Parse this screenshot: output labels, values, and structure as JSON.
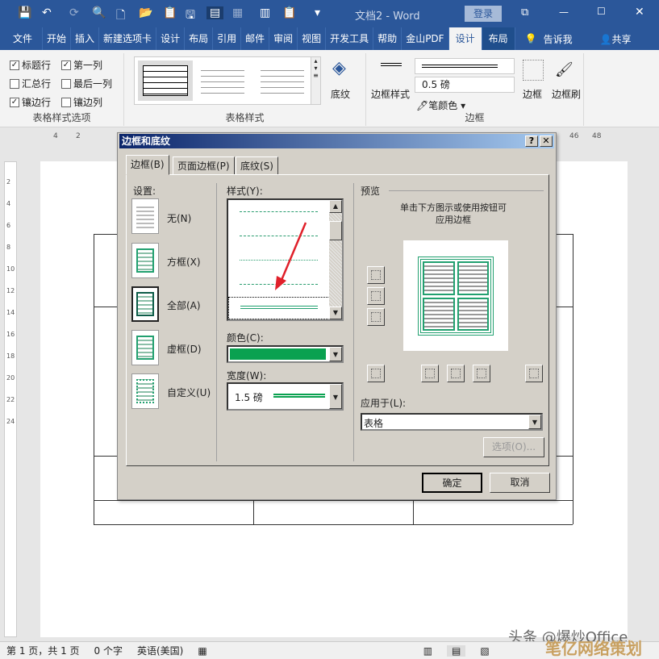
{
  "window": {
    "title": "文档2 - Word",
    "login": "登录",
    "min": "—",
    "max": "☐",
    "close": "✕",
    "restore": "⧉"
  },
  "quick_access": [
    "💾",
    "↶",
    "⟳",
    "🔍",
    "🗋",
    "📂",
    "📋",
    "🖫",
    "▤",
    "▦",
    "▥",
    "📋",
    "▾"
  ],
  "tabs": [
    {
      "label": "文件"
    },
    {
      "label": "开始"
    },
    {
      "label": "插入"
    },
    {
      "label": "新建选项卡"
    },
    {
      "label": "设计"
    },
    {
      "label": "布局"
    },
    {
      "label": "引用"
    },
    {
      "label": "邮件"
    },
    {
      "label": "审阅"
    },
    {
      "label": "视图"
    },
    {
      "label": "开发工具"
    },
    {
      "label": "帮助"
    },
    {
      "label": "金山PDF"
    },
    {
      "label": "设计"
    },
    {
      "label": "布局"
    }
  ],
  "tell_me": "告诉我",
  "share": "共享",
  "ribbon": {
    "style_options": {
      "label": "表格样式选项",
      "items": [
        {
          "label": "标题行",
          "checked": true
        },
        {
          "label": "第一列",
          "checked": true
        },
        {
          "label": "汇总行",
          "checked": false
        },
        {
          "label": "最后一列",
          "checked": false
        },
        {
          "label": "镶边行",
          "checked": true
        },
        {
          "label": "镶边列",
          "checked": false
        }
      ]
    },
    "table_styles": {
      "label": "表格样式",
      "shading": "底纹"
    },
    "borders": {
      "label": "边框",
      "border_styles": "边框样式",
      "weight": "0.5 磅",
      "pen_color": "笔颜色",
      "borders": "边框",
      "painter": "边框刷"
    }
  },
  "ruler": {
    "ticks": [
      "4",
      "2",
      "",
      "46",
      "48"
    ]
  },
  "vruler": [
    "2",
    "4",
    "6",
    "8",
    "10",
    "12",
    "14",
    "16",
    "18",
    "20",
    "22",
    "24"
  ],
  "dialog": {
    "title": "边框和底纹",
    "help": "?",
    "close": "✕",
    "tabs": [
      "边框(B)",
      "页面边框(P)",
      "底纹(S)"
    ],
    "settings_label": "设置:",
    "settings": [
      "无(N)",
      "方框(X)",
      "全部(A)",
      "虚框(D)",
      "自定义(U)"
    ],
    "style_label": "样式(Y):",
    "color_label": "颜色(C):",
    "color": "#0aa150",
    "width_label": "宽度(W):",
    "width": "1.5 磅",
    "preview_label": "预览",
    "preview_hint1": "单击下方图示或使用按钮可",
    "preview_hint2": "应用边框",
    "apply_label": "应用于(L):",
    "apply_value": "表格",
    "options": "选项(O)...",
    "ok": "确定",
    "cancel": "取消"
  },
  "status": {
    "page": "第 1 页，共 1 页",
    "words": "0 个字",
    "lang": "英语(美国)"
  },
  "watermark": "头条 @爆炒Office",
  "watermark2": "笔亿网络策划"
}
